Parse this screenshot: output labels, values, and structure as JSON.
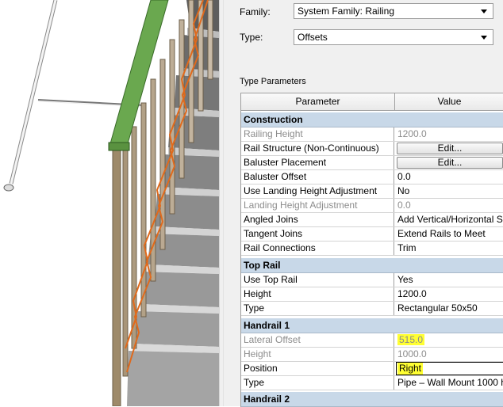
{
  "family": {
    "label": "Family:",
    "value": "System Family: Railing"
  },
  "type": {
    "label": "Type:",
    "value": "Offsets"
  },
  "type_parameters_label": "Type Parameters",
  "grid": {
    "col_parameter": "Parameter",
    "col_value": "Value",
    "construction": {
      "title": "Construction",
      "railing_height": {
        "name": "Railing Height",
        "value": "1200.0"
      },
      "rail_structure": {
        "name": "Rail Structure (Non-Continuous)",
        "value": "Edit..."
      },
      "baluster_placement": {
        "name": "Baluster Placement",
        "value": "Edit..."
      },
      "baluster_offset": {
        "name": "Baluster Offset",
        "value": "0.0"
      },
      "use_landing_height": {
        "name": "Use Landing Height Adjustment",
        "value": "No"
      },
      "landing_height": {
        "name": "Landing Height Adjustment",
        "value": "0.0"
      },
      "angled_joins": {
        "name": "Angled Joins",
        "value": "Add Vertical/Horizontal S"
      },
      "tangent_joins": {
        "name": "Tangent Joins",
        "value": "Extend Rails to Meet"
      },
      "rail_connections": {
        "name": "Rail Connections",
        "value": "Trim"
      }
    },
    "top_rail": {
      "title": "Top Rail",
      "use_top_rail": {
        "name": "Use Top Rail",
        "value": "Yes"
      },
      "height": {
        "name": "Height",
        "value": "1200.0"
      },
      "type": {
        "name": "Type",
        "value": "Rectangular 50x50"
      }
    },
    "handrail1": {
      "title": "Handrail 1",
      "lateral_offset": {
        "name": "Lateral Offset",
        "value": "515.0"
      },
      "height": {
        "name": "Height",
        "value": "1000.0"
      },
      "position": {
        "name": "Position",
        "value": "Right"
      },
      "type": {
        "name": "Type",
        "value": "Pipe – Wall Mount 1000 h"
      }
    },
    "handrail2": {
      "title": "Handrail 2"
    }
  },
  "colors": {
    "group_header": "#c8d8e8",
    "highlight": "#ffff33",
    "top_rail": "#6aa84f",
    "handrail_orange": "#e06a1c"
  },
  "viewport": {
    "content": "3D stair view with balusters, green top rail and wall-mounted pipe handrail"
  }
}
